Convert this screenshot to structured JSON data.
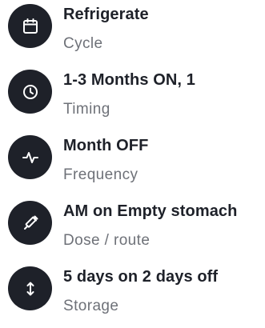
{
  "items": [
    {
      "title": "Refrigerate",
      "label": "Cycle",
      "icon": "calendar-icon"
    },
    {
      "title": "1-3 Months ON, 1",
      "label": "Timing",
      "icon": "clock-icon"
    },
    {
      "title": "Month OFF",
      "label": "Frequency",
      "icon": "pulse-icon"
    },
    {
      "title": "AM on Empty stomach",
      "label": "Dose / route",
      "icon": "syringe-icon"
    },
    {
      "title": "5 days on 2 days off",
      "label": "Storage",
      "icon": "vertical-arrows-icon"
    }
  ],
  "colors": {
    "icon_background": "#1e2129",
    "title_text": "#1e2129",
    "label_text": "#6e7178"
  }
}
